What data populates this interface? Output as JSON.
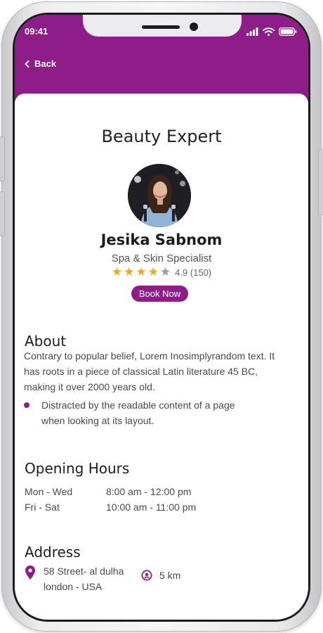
{
  "status": {
    "time": "09:41"
  },
  "nav": {
    "back_label": "Back"
  },
  "page": {
    "title": "Beauty Expert"
  },
  "expert": {
    "name": "Jesika Sabnom",
    "role": "Spa & Skin Specialist",
    "rating": 4,
    "rating_max": 5,
    "rating_text": "4.9 (150)",
    "book_label": "Book Now"
  },
  "about": {
    "title": "About",
    "text": "Contrary to popular belief, Lorem Inosimplyrandom text. It has roots in a piece of classical Latin literature 45 BC, making it over 2000 years old.",
    "bullet": "Distracted by the readable content of a page when looking at its layout."
  },
  "hours": {
    "title": "Opening Hours",
    "rows": [
      {
        "day": "Mon - Wed",
        "time": "8:00 am - 12:00 pm"
      },
      {
        "day": "Fri - Sat",
        "time": "10:00 am - 11:00 pm"
      }
    ]
  },
  "address": {
    "title": "Address",
    "line1": "58 Street- al dulha",
    "line2": "london - USA",
    "distance": "5 km"
  },
  "colors": {
    "brand": "#8e1c89",
    "star": "#f5a623",
    "star_off": "#9b9b9b"
  },
  "icons": {
    "back": "chevron-left-icon",
    "location": "location-pin-icon",
    "distance": "distance-icon",
    "signal": "signal-icon",
    "wifi": "wifi-icon",
    "battery": "battery-icon"
  }
}
